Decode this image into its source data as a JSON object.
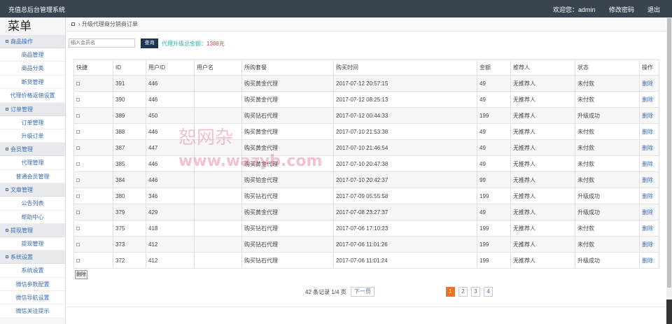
{
  "header": {
    "title": "充值总后台管理系统",
    "welcome": "欢迎您：admin",
    "change_password": "修改密码",
    "logout": "退出"
  },
  "sidebar": {
    "menu_title": "菜单",
    "sections": [
      {
        "label": "商品操作",
        "items": [
          "商品管理",
          "商品分类",
          "断货管理",
          "代理价格返佣设置"
        ]
      },
      {
        "label": "订单管理",
        "items": [
          "订单管理",
          "升级订单"
        ]
      },
      {
        "label": "会员管理",
        "items": [
          "代理管理",
          "普通会员管理"
        ]
      },
      {
        "label": "文章管理",
        "items": [
          "公告列表",
          "帮助中心"
        ]
      },
      {
        "label": "提现管理",
        "items": [
          "提现管理"
        ]
      },
      {
        "label": "系统设置",
        "items": [
          "系统设置",
          "微信参数配置",
          "微信导航设置",
          "微信关注提示"
        ]
      }
    ]
  },
  "breadcrumb": {
    "home_icon": "home-icon",
    "separator": "›",
    "current": "升级代理商分销商订单"
  },
  "search": {
    "placeholder": "输入会员名",
    "button": "查询",
    "total_label": "代理升级总金额：",
    "total_value": "1388元"
  },
  "table": {
    "headers": [
      "快捷",
      "ID",
      "用户ID",
      "用户名",
      "所购套餐",
      "购买时间",
      "金额",
      "推荐人",
      "状态",
      "操作"
    ],
    "rows": [
      {
        "id": "391",
        "uid": "446",
        "username": "",
        "plan": "购买黄金代理",
        "time": "2017-07-12 20:57:15",
        "amount": "49",
        "referrer": "无推荐人",
        "status": "未付款",
        "op": "删除"
      },
      {
        "id": "390",
        "uid": "446",
        "username": "",
        "plan": "购买黄金代理",
        "time": "2017-07-12 08:25:13",
        "amount": "49",
        "referrer": "无推荐人",
        "status": "未付款",
        "op": "删除"
      },
      {
        "id": "389",
        "uid": "450",
        "username": "",
        "plan": "购买钻石代理",
        "time": "2017-07-12 00:44:33",
        "amount": "199",
        "referrer": "无推荐人",
        "status": "升级成功",
        "op": "删除"
      },
      {
        "id": "388",
        "uid": "446",
        "username": "",
        "plan": "购买黄金代理",
        "time": "2017-07-10 21:53:38",
        "amount": "49",
        "referrer": "无推荐人",
        "status": "未付款",
        "op": "删除"
      },
      {
        "id": "387",
        "uid": "447",
        "username": "",
        "plan": "购买黄金代理",
        "time": "2017-07-10 21:46:54",
        "amount": "49",
        "referrer": "无推荐人",
        "status": "未付款",
        "op": "删除"
      },
      {
        "id": "385",
        "uid": "446",
        "username": "",
        "plan": "购买黄金代理",
        "time": "2017-07-10 20:47:38",
        "amount": "49",
        "referrer": "无推荐人",
        "status": "未付款",
        "op": "删除"
      },
      {
        "id": "384",
        "uid": "446",
        "username": "",
        "plan": "购买铂金代理",
        "time": "2017-07-10 20:42:37",
        "amount": "99",
        "referrer": "无推荐人",
        "status": "未付款",
        "op": "删除"
      },
      {
        "id": "380",
        "uid": "346",
        "username": "",
        "plan": "购买钻石代理",
        "time": "2017-07-09 05:55:58",
        "amount": "199",
        "referrer": "无推荐人",
        "status": "升级成功",
        "op": "删除"
      },
      {
        "id": "379",
        "uid": "429",
        "username": "",
        "plan": "购买黄金代理",
        "time": "2017-07-08 23:27:37",
        "amount": "49",
        "referrer": "无推荐人",
        "status": "升级成功",
        "op": "删除"
      },
      {
        "id": "375",
        "uid": "418",
        "username": "",
        "plan": "购买钻石代理",
        "time": "2017-07-06 17:10:23",
        "amount": "199",
        "referrer": "无推荐人",
        "status": "未付款",
        "op": "删除"
      },
      {
        "id": "373",
        "uid": "412",
        "username": "",
        "plan": "购买钻石代理",
        "time": "2017-07-06 11:01:26",
        "amount": "199",
        "referrer": "无推荐人",
        "status": "未付款",
        "op": "删除"
      },
      {
        "id": "372",
        "uid": "412",
        "username": "",
        "plan": "购买钻石代理",
        "time": "2017-07-06 11:01:24",
        "amount": "199",
        "referrer": "无推荐人",
        "status": "升级成功",
        "op": "删除"
      }
    ],
    "delete_button": "删除"
  },
  "pager": {
    "info": "42 条记录 1/4 页",
    "next": "下一页",
    "pages": [
      "1",
      "2",
      "3",
      "4"
    ],
    "current": "1"
  },
  "watermark": {
    "line1": "恕网杂",
    "line2": "www.wazyb.com"
  },
  "colors": {
    "topbar": "#3a4451",
    "accent": "#3a6db5",
    "active_page": "#f4711f",
    "search_button": "#1e3555"
  }
}
